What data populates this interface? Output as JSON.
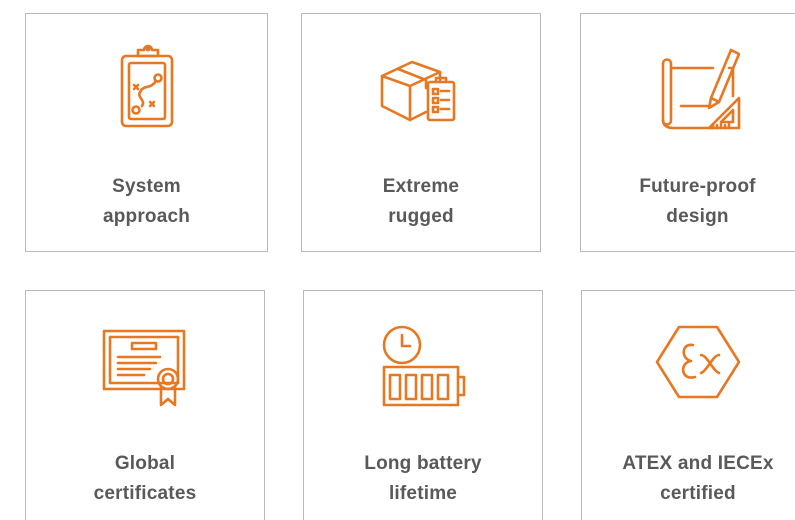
{
  "accent_color": "#e87722",
  "features": [
    {
      "icon": "clipboard-plan-icon",
      "lines": [
        "System",
        "approach"
      ]
    },
    {
      "icon": "rugged-box-checklist-icon",
      "lines": [
        "Extreme",
        "rugged"
      ]
    },
    {
      "icon": "design-blueprint-icon",
      "lines": [
        "Future-proof",
        "design"
      ]
    },
    {
      "icon": "certificate-icon",
      "lines": [
        "Global",
        "certificates"
      ]
    },
    {
      "icon": "battery-clock-icon",
      "lines": [
        "Long battery",
        "lifetime"
      ]
    },
    {
      "icon": "atex-ex-icon",
      "lines": [
        "ATEX and IECEx",
        "certified"
      ]
    }
  ]
}
